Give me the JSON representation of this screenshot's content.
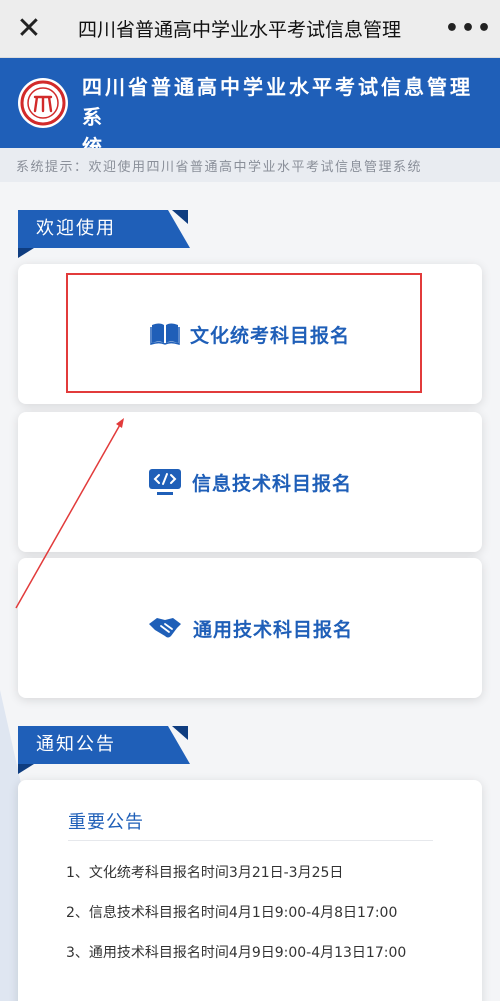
{
  "nav": {
    "close_label": "✕",
    "title": "四川省普通高中学业水平考试信息管理",
    "more_label": "•••"
  },
  "header": {
    "title_line1": "四川省普通高中学业水平考试信息管理系",
    "title_line2": "统"
  },
  "tip": {
    "text": "系统提示：欢迎使用四川省普通高中学业水平考试信息管理系统"
  },
  "welcome_section": {
    "label": "欢迎使用"
  },
  "cards": [
    {
      "label": "文化统考科目报名",
      "icon": "book-icon"
    },
    {
      "label": "信息技术科目报名",
      "icon": "code-icon"
    },
    {
      "label": "通用技术科目报名",
      "icon": "handshake-icon"
    }
  ],
  "notice_section": {
    "label": "通知公告"
  },
  "notice": {
    "heading": "重要公告",
    "items": [
      "1、文化统考科目报名时间3月21日-3月25日",
      "2、信息技术科目报名时间4月1日9:00-4月8日17:00",
      "3、通用技术科目报名时间4月9日9:00-4月13日17:00"
    ]
  },
  "colors": {
    "primary": "#1f5fb8",
    "highlight": "#e23b3b"
  }
}
